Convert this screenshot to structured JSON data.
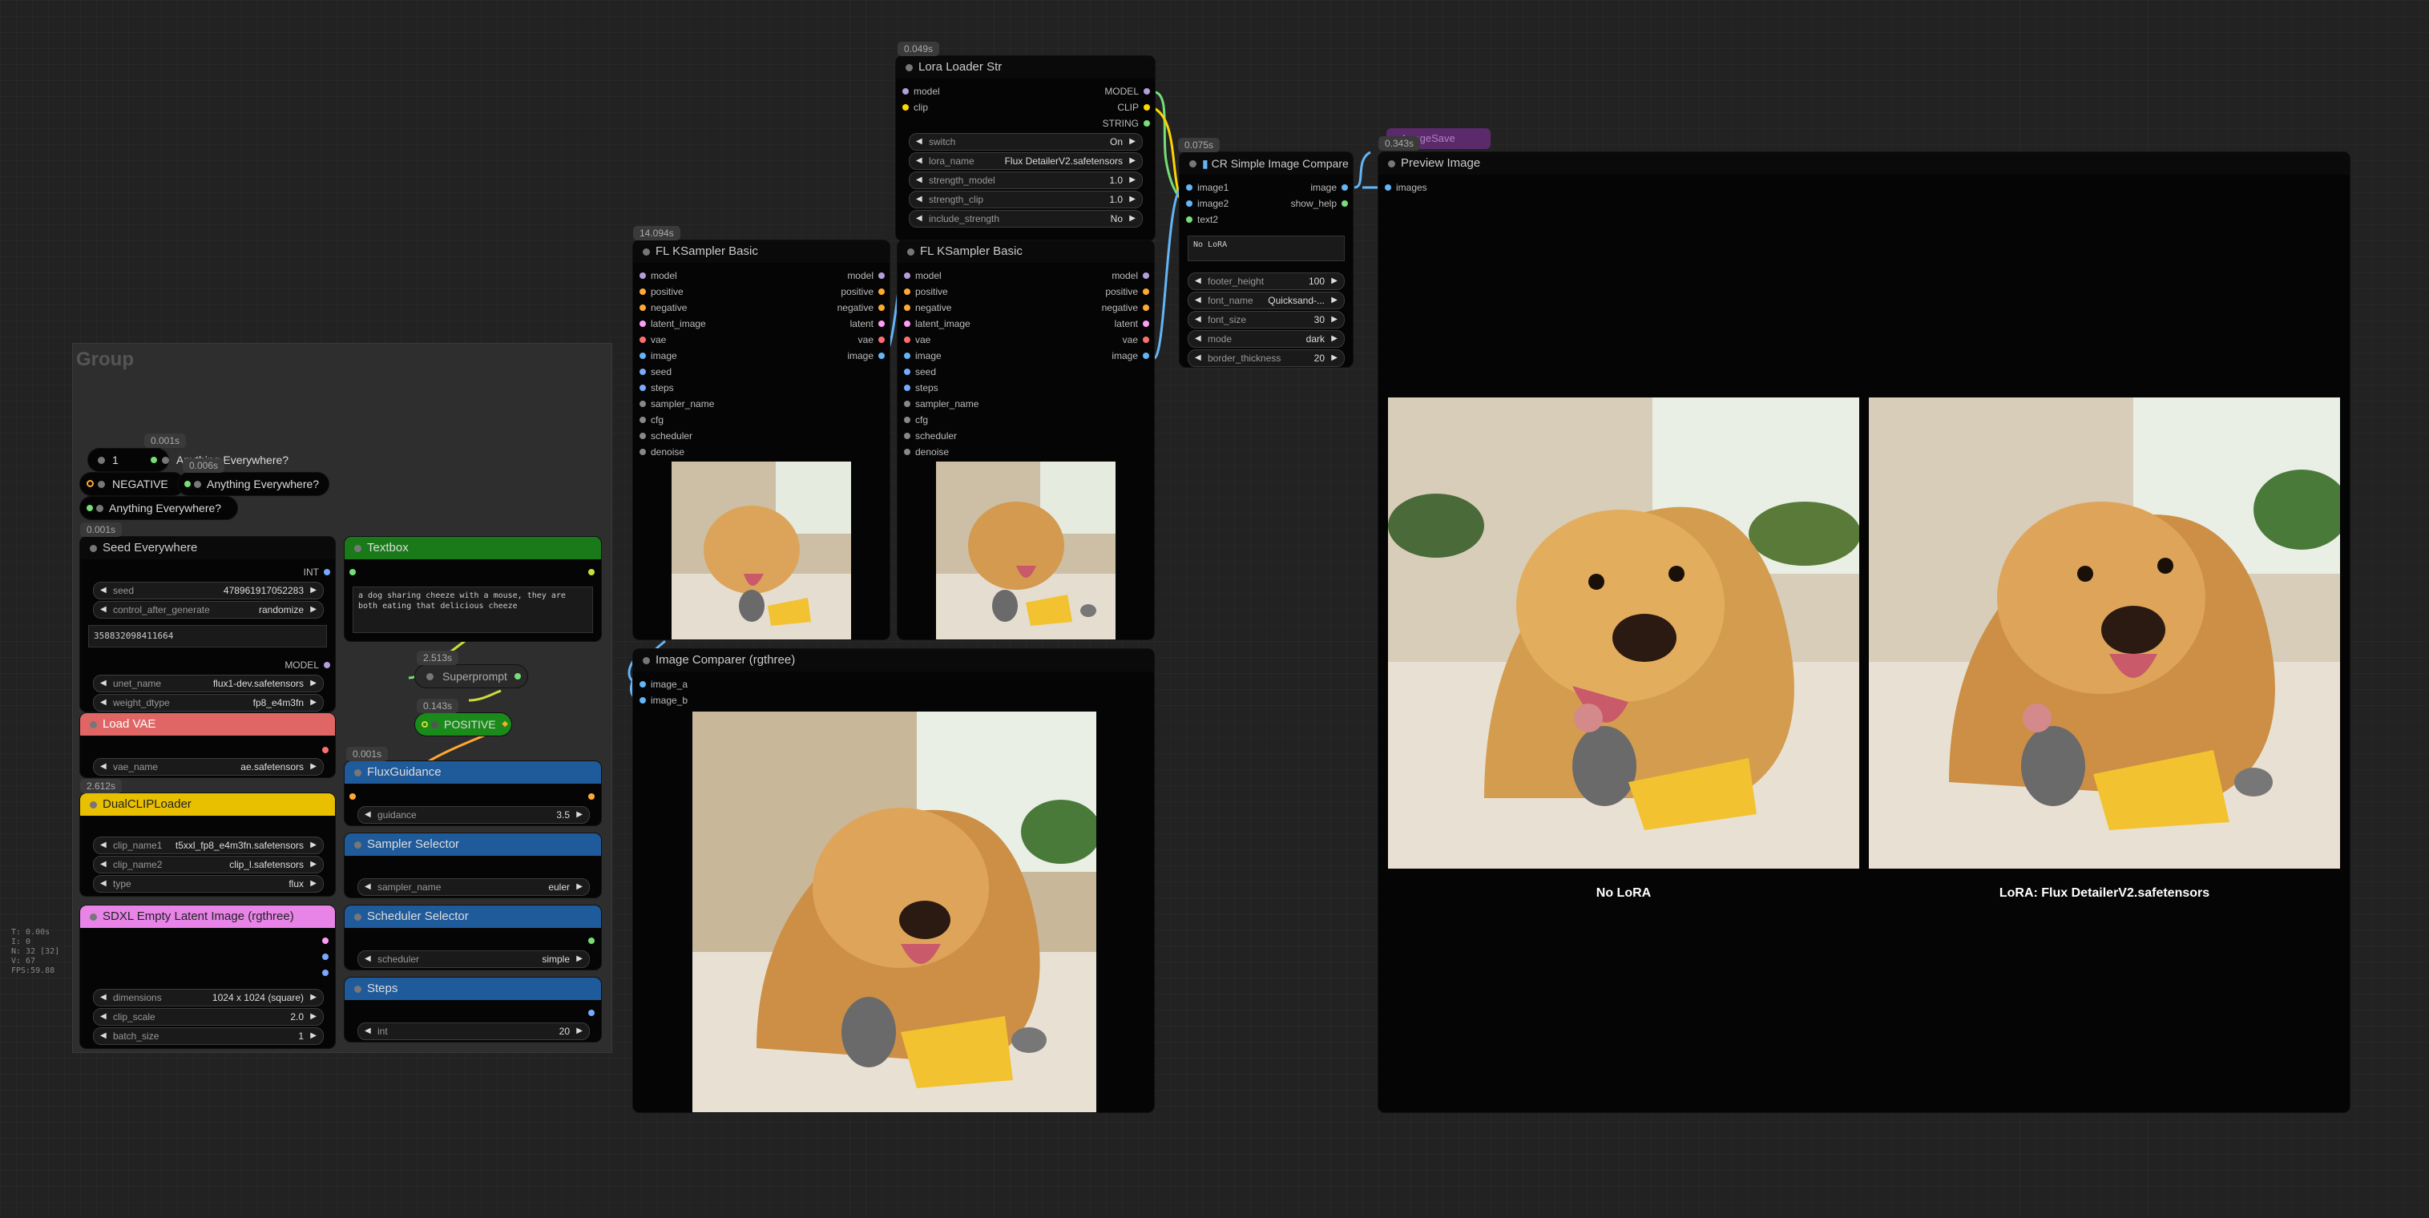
{
  "group": {
    "title": "Group"
  },
  "stats": [
    "T: 0.00s",
    "I: 0",
    "N: 32 [32]",
    "V: 67",
    "FPS:59.88"
  ],
  "timings": {
    "lora": "0.049s",
    "ksampler1": "14.094s",
    "cr_compare": "0.075s",
    "preview": "0.343s",
    "any1": "0.001s",
    "any2": "0.006s",
    "seed": "0.001s",
    "superprompt": "2.513s",
    "positive": "0.143s",
    "flux_guidance": "0.001s",
    "dualclip": "2.612s"
  },
  "lora_loader": {
    "title": "Lora Loader Str",
    "inputs": [
      "model",
      "clip"
    ],
    "outputs": [
      "MODEL",
      "CLIP",
      "STRING"
    ],
    "widgets": [
      {
        "label": "switch",
        "value": "On"
      },
      {
        "label": "lora_name",
        "value": "Flux DetailerV2.safetensors"
      },
      {
        "label": "strength_model",
        "value": "1.0"
      },
      {
        "label": "strength_clip",
        "value": "1.0"
      },
      {
        "label": "include_strength",
        "value": "No"
      }
    ]
  },
  "cr_compare": {
    "title": "CR Simple Image Compare",
    "inputs": [
      "image1",
      "image2",
      "text2"
    ],
    "outputs": [
      "image",
      "show_help"
    ],
    "text": "No LoRA",
    "widgets": [
      {
        "label": "footer_height",
        "value": "100"
      },
      {
        "label": "font_name",
        "value": "Quicksand-..."
      },
      {
        "label": "font_size",
        "value": "30"
      },
      {
        "label": "mode",
        "value": "dark"
      },
      {
        "label": "border_thickness",
        "value": "20"
      }
    ]
  },
  "preview": {
    "title": "Preview Image",
    "input": "images",
    "ghost": "ImageSave",
    "caption_left": "No LoRA",
    "caption_right": "LoRA: Flux DetailerV2.safetensors"
  },
  "ksampler": {
    "title": "FL KSampler Basic",
    "inputs": [
      "model",
      "positive",
      "negative",
      "latent_image",
      "vae",
      "image",
      "seed",
      "steps",
      "sampler_name",
      "cfg",
      "scheduler",
      "denoise"
    ],
    "outputs": [
      "model",
      "positive",
      "negative",
      "latent",
      "vae",
      "image"
    ]
  },
  "image_comparer": {
    "title": "Image Comparer (rgthree)",
    "inputs": [
      "image_a",
      "image_b"
    ]
  },
  "anything": {
    "n1": "1",
    "any_label": "Anything Everywhere?",
    "negative": "NEGATIVE",
    "any_label2": "Anything Everywhere?",
    "any_label3": "Anything Everywhere?"
  },
  "seed_everywhere": {
    "title": "Seed Everywhere",
    "out": "INT",
    "widgets": [
      {
        "label": "seed",
        "value": "478961917052283"
      },
      {
        "label": "control_after_generate",
        "value": "randomize"
      }
    ],
    "value": "358832098411664",
    "out2": "MODEL",
    "widgets2": [
      {
        "label": "unet_name",
        "value": "flux1-dev.safetensors"
      },
      {
        "label": "weight_dtype",
        "value": "fp8_e4m3fn"
      }
    ]
  },
  "load_vae": {
    "title": "Load VAE",
    "widgets": [
      {
        "label": "vae_name",
        "value": "ae.safetensors"
      }
    ]
  },
  "dualclip": {
    "title": "DualCLIPLoader",
    "widgets": [
      {
        "label": "clip_name1",
        "value": "t5xxl_fp8_e4m3fn.safetensors"
      },
      {
        "label": "clip_name2",
        "value": "clip_l.safetensors"
      },
      {
        "label": "type",
        "value": "flux"
      }
    ]
  },
  "sdxl_latent": {
    "title": "SDXL Empty Latent Image (rgthree)",
    "widgets": [
      {
        "label": "dimensions",
        "value": "1024 x 1024  (square)"
      },
      {
        "label": "clip_scale",
        "value": "2.0"
      },
      {
        "label": "batch_size",
        "value": "1"
      }
    ]
  },
  "textbox": {
    "title": "Textbox",
    "text": "a dog sharing cheeze with a mouse, they are both eating that delicious cheeze"
  },
  "superprompt": {
    "title": "Superprompt"
  },
  "positive": {
    "title": "POSITIVE"
  },
  "flux_guidance": {
    "title": "FluxGuidance",
    "widgets": [
      {
        "label": "guidance",
        "value": "3.5"
      }
    ]
  },
  "sampler_selector": {
    "title": "Sampler Selector",
    "widgets": [
      {
        "label": "sampler_name",
        "value": "euler"
      }
    ]
  },
  "scheduler_selector": {
    "title": "Scheduler Selector",
    "widgets": [
      {
        "label": "scheduler",
        "value": "simple"
      }
    ]
  },
  "steps": {
    "title": "Steps",
    "widgets": [
      {
        "label": "int",
        "value": "20"
      }
    ]
  },
  "colors": {
    "model": "#b39ddb",
    "clip": "#ffd500",
    "string": "#77dd77",
    "image": "#64b5f6",
    "positive": "#ffa931",
    "negative": "#ff6e6e",
    "latent": "#ff9cf9",
    "vae": "#ff6e6e",
    "int": "#77aaff"
  }
}
